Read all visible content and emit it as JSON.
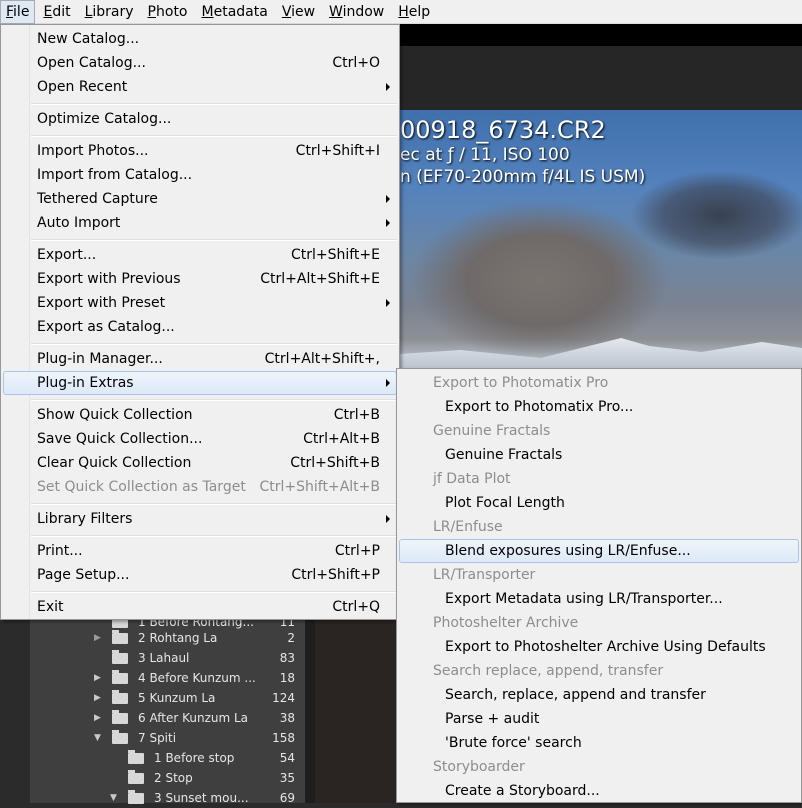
{
  "menubar": {
    "items": [
      {
        "label": "File",
        "mnemonic": "F",
        "rest": "ile"
      },
      {
        "label": "Edit",
        "mnemonic": "E",
        "rest": "dit"
      },
      {
        "label": "Library",
        "mnemonic": "L",
        "rest": "ibrary"
      },
      {
        "label": "Photo",
        "mnemonic": "P",
        "rest": "hoto"
      },
      {
        "label": "Metadata",
        "mnemonic": "M",
        "rest": "etadata"
      },
      {
        "label": "View",
        "mnemonic": "V",
        "rest": "iew"
      },
      {
        "label": "Window",
        "mnemonic": "W",
        "rest": "indow"
      },
      {
        "label": "Help",
        "mnemonic": "H",
        "rest": "elp"
      }
    ]
  },
  "photo_info": {
    "filename": "00918_6734.CR2",
    "exposure": "ec at ƒ / 11, ISO 100",
    "lens": "n (EF70-200mm f/4L IS USM)"
  },
  "file_menu": {
    "items": [
      {
        "label": "New Catalog...",
        "shortcut": ""
      },
      {
        "label": "Open Catalog...",
        "shortcut": "Ctrl+O"
      },
      {
        "label": "Open Recent",
        "shortcut": ""
      },
      {
        "label": "Optimize Catalog...",
        "shortcut": ""
      },
      {
        "label": "Import Photos...",
        "shortcut": "Ctrl+Shift+I"
      },
      {
        "label": "Import from Catalog...",
        "shortcut": ""
      },
      {
        "label": "Tethered Capture",
        "shortcut": ""
      },
      {
        "label": "Auto Import",
        "shortcut": ""
      },
      {
        "label": "Export...",
        "shortcut": "Ctrl+Shift+E"
      },
      {
        "label": "Export with Previous",
        "shortcut": "Ctrl+Alt+Shift+E"
      },
      {
        "label": "Export with Preset",
        "shortcut": ""
      },
      {
        "label": "Export as Catalog...",
        "shortcut": ""
      },
      {
        "label": "Plug-in Manager...",
        "shortcut": "Ctrl+Alt+Shift+,"
      },
      {
        "label": "Plug-in Extras",
        "shortcut": ""
      },
      {
        "label": "Show Quick Collection",
        "shortcut": "Ctrl+B"
      },
      {
        "label": "Save Quick Collection...",
        "shortcut": "Ctrl+Alt+B"
      },
      {
        "label": "Clear Quick Collection",
        "shortcut": "Ctrl+Shift+B"
      },
      {
        "label": "Set Quick Collection as Target",
        "shortcut": "Ctrl+Shift+Alt+B"
      },
      {
        "label": "Library Filters",
        "shortcut": ""
      },
      {
        "label": "Print...",
        "shortcut": "Ctrl+P"
      },
      {
        "label": "Page Setup...",
        "shortcut": "Ctrl+Shift+P"
      },
      {
        "label": "Exit",
        "shortcut": "Ctrl+Q"
      }
    ]
  },
  "plugin_extras_menu": {
    "items": [
      {
        "label": "Export to Photomatix Pro",
        "kind": "header"
      },
      {
        "label": "Export to Photomatix Pro...",
        "kind": "item"
      },
      {
        "label": "Genuine Fractals",
        "kind": "header"
      },
      {
        "label": "Genuine Fractals",
        "kind": "item"
      },
      {
        "label": "jf Data Plot",
        "kind": "header"
      },
      {
        "label": "Plot Focal Length",
        "kind": "item"
      },
      {
        "label": "LR/Enfuse",
        "kind": "header"
      },
      {
        "label": "Blend exposures using LR/Enfuse...",
        "kind": "item"
      },
      {
        "label": "LR/Transporter",
        "kind": "header"
      },
      {
        "label": "Export Metadata using LR/Transporter...",
        "kind": "item"
      },
      {
        "label": "Photoshelter Archive",
        "kind": "header"
      },
      {
        "label": "Export to Photoshelter Archive Using Defaults",
        "kind": "item"
      },
      {
        "label": "Search  replace, append, transfer",
        "kind": "header"
      },
      {
        "label": "Search, replace, append and transfer",
        "kind": "item"
      },
      {
        "label": "Parse + audit",
        "kind": "item"
      },
      {
        "label": "'Brute force' search",
        "kind": "item"
      },
      {
        "label": "Storyboarder",
        "kind": "header"
      },
      {
        "label": "Create a Storyboard...",
        "kind": "item"
      }
    ]
  },
  "folders": [
    {
      "name": "1 Before Rohtang...",
      "count": "11"
    },
    {
      "name": "2 Rohtang La",
      "count": "2"
    },
    {
      "name": "3 Lahaul",
      "count": "83"
    },
    {
      "name": "4 Before Kunzum ...",
      "count": "18"
    },
    {
      "name": "5 Kunzum La",
      "count": "124"
    },
    {
      "name": "6 After Kunzum La",
      "count": "38"
    },
    {
      "name": "7 Spiti",
      "count": "158"
    },
    {
      "name": "1 Before stop",
      "count": "54"
    },
    {
      "name": "2 Stop",
      "count": "35"
    },
    {
      "name": "3 Sunset mou...",
      "count": "69"
    }
  ]
}
